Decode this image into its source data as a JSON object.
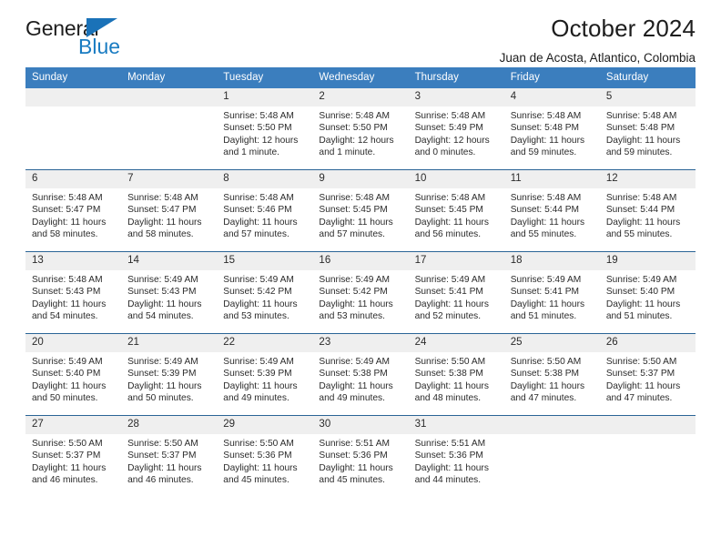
{
  "brand": {
    "name_part1": "General",
    "name_part2": "Blue",
    "triangle_icon": "triangle-icon"
  },
  "header": {
    "title": "October 2024",
    "subtitle": "Juan de Acosta, Atlantico, Colombia"
  },
  "colors": {
    "header_blue": "#3b7ebe",
    "border_blue": "#2a6496",
    "daynum_gray": "#efefef",
    "brand_blue": "#1a7cc2"
  },
  "weekday_headers": [
    "Sunday",
    "Monday",
    "Tuesday",
    "Wednesday",
    "Thursday",
    "Friday",
    "Saturday"
  ],
  "weeks": [
    [
      {
        "day": "",
        "blank": true
      },
      {
        "day": "",
        "blank": true
      },
      {
        "day": "1",
        "sunrise": "Sunrise: 5:48 AM",
        "sunset": "Sunset: 5:50 PM",
        "daylight": "Daylight: 12 hours and 1 minute."
      },
      {
        "day": "2",
        "sunrise": "Sunrise: 5:48 AM",
        "sunset": "Sunset: 5:50 PM",
        "daylight": "Daylight: 12 hours and 1 minute."
      },
      {
        "day": "3",
        "sunrise": "Sunrise: 5:48 AM",
        "sunset": "Sunset: 5:49 PM",
        "daylight": "Daylight: 12 hours and 0 minutes."
      },
      {
        "day": "4",
        "sunrise": "Sunrise: 5:48 AM",
        "sunset": "Sunset: 5:48 PM",
        "daylight": "Daylight: 11 hours and 59 minutes."
      },
      {
        "day": "5",
        "sunrise": "Sunrise: 5:48 AM",
        "sunset": "Sunset: 5:48 PM",
        "daylight": "Daylight: 11 hours and 59 minutes."
      }
    ],
    [
      {
        "day": "6",
        "sunrise": "Sunrise: 5:48 AM",
        "sunset": "Sunset: 5:47 PM",
        "daylight": "Daylight: 11 hours and 58 minutes."
      },
      {
        "day": "7",
        "sunrise": "Sunrise: 5:48 AM",
        "sunset": "Sunset: 5:47 PM",
        "daylight": "Daylight: 11 hours and 58 minutes."
      },
      {
        "day": "8",
        "sunrise": "Sunrise: 5:48 AM",
        "sunset": "Sunset: 5:46 PM",
        "daylight": "Daylight: 11 hours and 57 minutes."
      },
      {
        "day": "9",
        "sunrise": "Sunrise: 5:48 AM",
        "sunset": "Sunset: 5:45 PM",
        "daylight": "Daylight: 11 hours and 57 minutes."
      },
      {
        "day": "10",
        "sunrise": "Sunrise: 5:48 AM",
        "sunset": "Sunset: 5:45 PM",
        "daylight": "Daylight: 11 hours and 56 minutes."
      },
      {
        "day": "11",
        "sunrise": "Sunrise: 5:48 AM",
        "sunset": "Sunset: 5:44 PM",
        "daylight": "Daylight: 11 hours and 55 minutes."
      },
      {
        "day": "12",
        "sunrise": "Sunrise: 5:48 AM",
        "sunset": "Sunset: 5:44 PM",
        "daylight": "Daylight: 11 hours and 55 minutes."
      }
    ],
    [
      {
        "day": "13",
        "sunrise": "Sunrise: 5:48 AM",
        "sunset": "Sunset: 5:43 PM",
        "daylight": "Daylight: 11 hours and 54 minutes."
      },
      {
        "day": "14",
        "sunrise": "Sunrise: 5:49 AM",
        "sunset": "Sunset: 5:43 PM",
        "daylight": "Daylight: 11 hours and 54 minutes."
      },
      {
        "day": "15",
        "sunrise": "Sunrise: 5:49 AM",
        "sunset": "Sunset: 5:42 PM",
        "daylight": "Daylight: 11 hours and 53 minutes."
      },
      {
        "day": "16",
        "sunrise": "Sunrise: 5:49 AM",
        "sunset": "Sunset: 5:42 PM",
        "daylight": "Daylight: 11 hours and 53 minutes."
      },
      {
        "day": "17",
        "sunrise": "Sunrise: 5:49 AM",
        "sunset": "Sunset: 5:41 PM",
        "daylight": "Daylight: 11 hours and 52 minutes."
      },
      {
        "day": "18",
        "sunrise": "Sunrise: 5:49 AM",
        "sunset": "Sunset: 5:41 PM",
        "daylight": "Daylight: 11 hours and 51 minutes."
      },
      {
        "day": "19",
        "sunrise": "Sunrise: 5:49 AM",
        "sunset": "Sunset: 5:40 PM",
        "daylight": "Daylight: 11 hours and 51 minutes."
      }
    ],
    [
      {
        "day": "20",
        "sunrise": "Sunrise: 5:49 AM",
        "sunset": "Sunset: 5:40 PM",
        "daylight": "Daylight: 11 hours and 50 minutes."
      },
      {
        "day": "21",
        "sunrise": "Sunrise: 5:49 AM",
        "sunset": "Sunset: 5:39 PM",
        "daylight": "Daylight: 11 hours and 50 minutes."
      },
      {
        "day": "22",
        "sunrise": "Sunrise: 5:49 AM",
        "sunset": "Sunset: 5:39 PM",
        "daylight": "Daylight: 11 hours and 49 minutes."
      },
      {
        "day": "23",
        "sunrise": "Sunrise: 5:49 AM",
        "sunset": "Sunset: 5:38 PM",
        "daylight": "Daylight: 11 hours and 49 minutes."
      },
      {
        "day": "24",
        "sunrise": "Sunrise: 5:50 AM",
        "sunset": "Sunset: 5:38 PM",
        "daylight": "Daylight: 11 hours and 48 minutes."
      },
      {
        "day": "25",
        "sunrise": "Sunrise: 5:50 AM",
        "sunset": "Sunset: 5:38 PM",
        "daylight": "Daylight: 11 hours and 47 minutes."
      },
      {
        "day": "26",
        "sunrise": "Sunrise: 5:50 AM",
        "sunset": "Sunset: 5:37 PM",
        "daylight": "Daylight: 11 hours and 47 minutes."
      }
    ],
    [
      {
        "day": "27",
        "sunrise": "Sunrise: 5:50 AM",
        "sunset": "Sunset: 5:37 PM",
        "daylight": "Daylight: 11 hours and 46 minutes."
      },
      {
        "day": "28",
        "sunrise": "Sunrise: 5:50 AM",
        "sunset": "Sunset: 5:37 PM",
        "daylight": "Daylight: 11 hours and 46 minutes."
      },
      {
        "day": "29",
        "sunrise": "Sunrise: 5:50 AM",
        "sunset": "Sunset: 5:36 PM",
        "daylight": "Daylight: 11 hours and 45 minutes."
      },
      {
        "day": "30",
        "sunrise": "Sunrise: 5:51 AM",
        "sunset": "Sunset: 5:36 PM",
        "daylight": "Daylight: 11 hours and 45 minutes."
      },
      {
        "day": "31",
        "sunrise": "Sunrise: 5:51 AM",
        "sunset": "Sunset: 5:36 PM",
        "daylight": "Daylight: 11 hours and 44 minutes."
      },
      {
        "day": "",
        "blank": true
      },
      {
        "day": "",
        "blank": true
      }
    ]
  ]
}
